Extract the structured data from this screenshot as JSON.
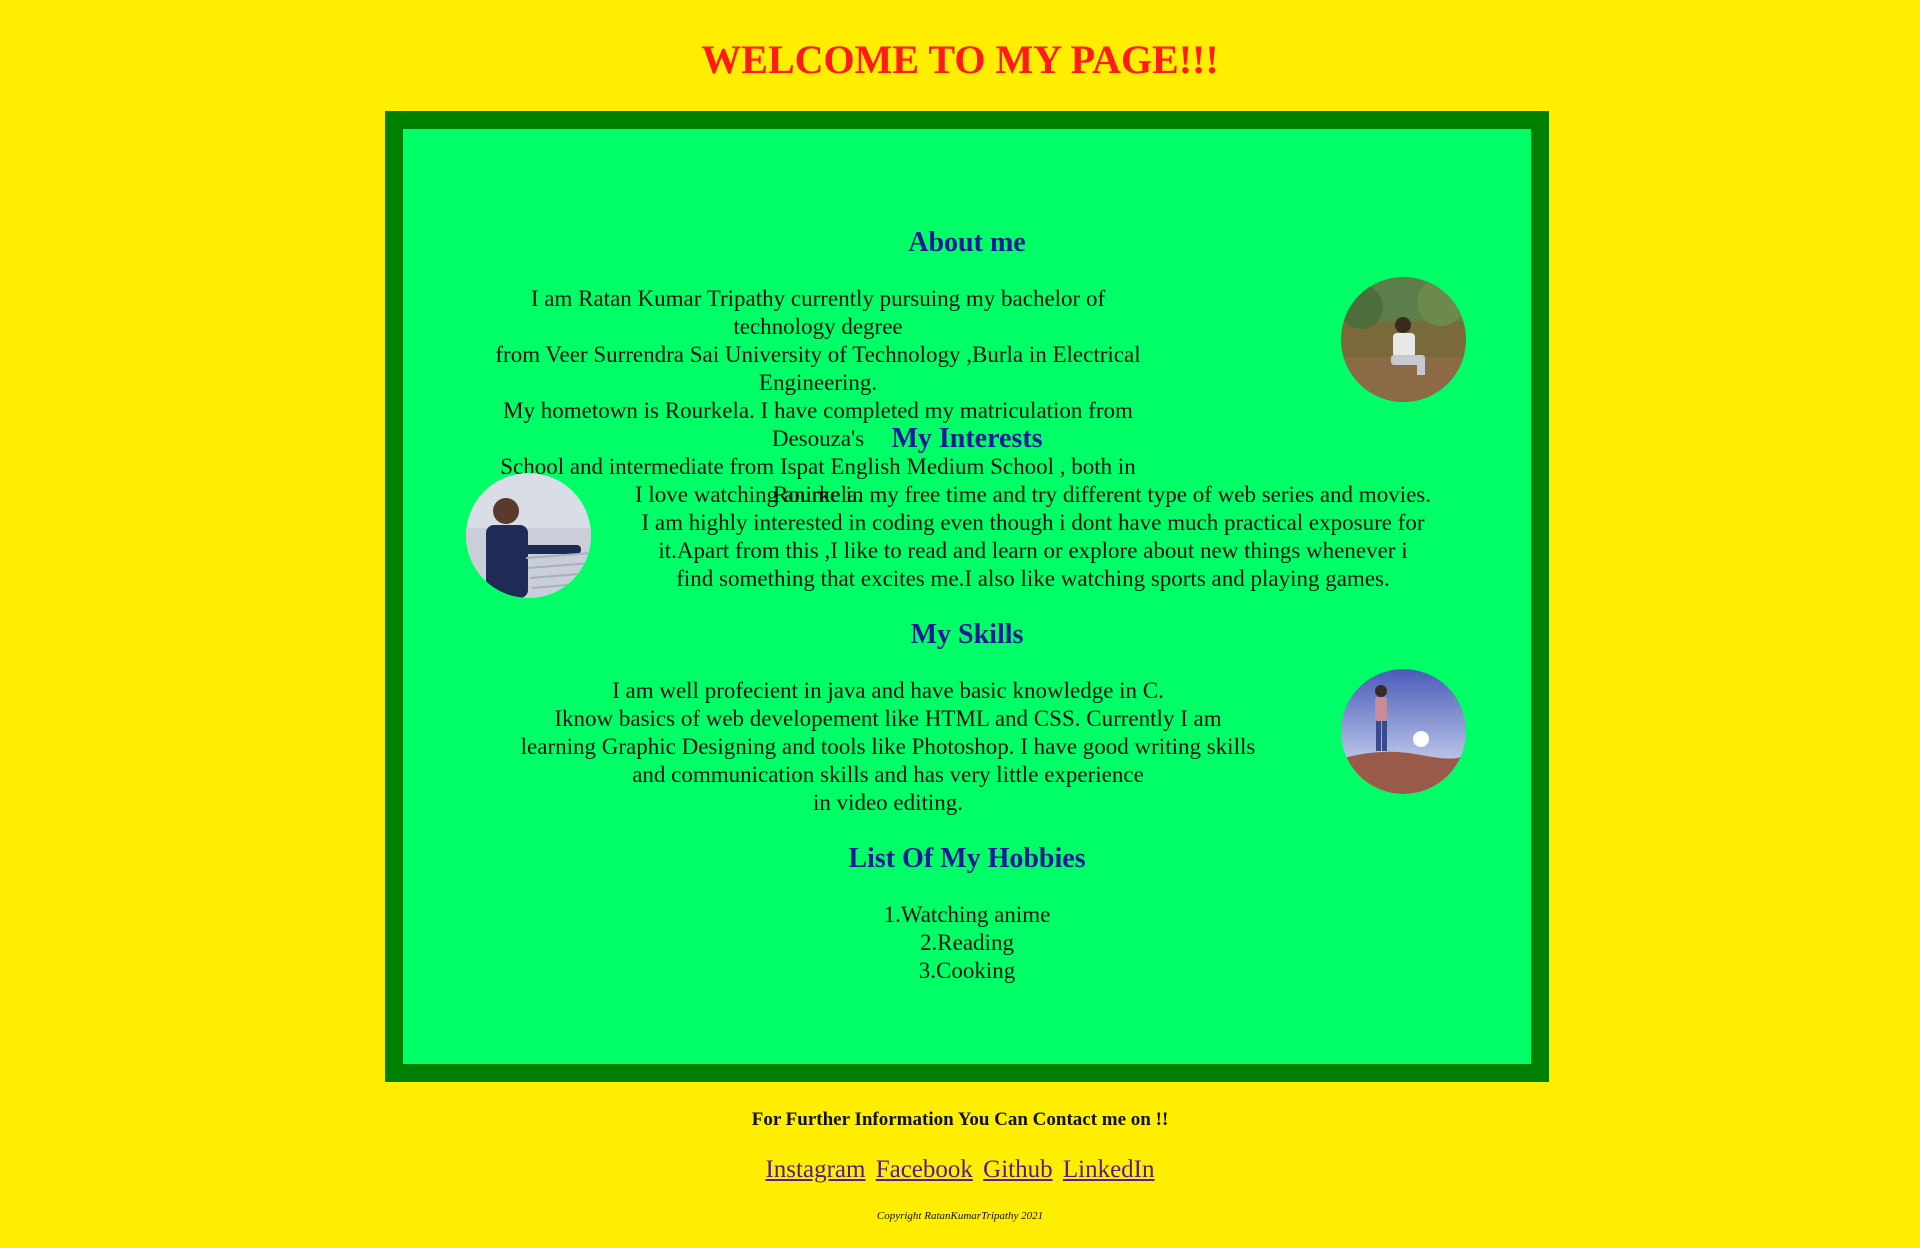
{
  "header": {
    "title": "WELCOME TO MY PAGE!!!"
  },
  "about": {
    "heading": "About me",
    "lines": [
      "I am Ratan Kumar Tripathy currently pursuing my bachelor of technology degree",
      "from Veer Surrendra Sai University of Technology ,Burla in Electrical Engineering.",
      "My hometown is Rourkela. I have completed my matriculation from Desouza's",
      "School and intermediate from Ispat English Medium School , both in Rourkela."
    ]
  },
  "interests": {
    "heading": "My Interests",
    "lines": [
      "I love watching anime in my free time and try different type of web series and movies.",
      "I am highly interested in coding even though i dont have much practical exposure for",
      "it.Apart from this ,I like to read and learn or explore about new things whenever i",
      "find something that excites me.I also like watching sports and playing games."
    ]
  },
  "skills": {
    "heading": "My Skills",
    "lines": [
      "I am well profecient in java and have basic knowledge in C.",
      "Iknow basics of web developement like HTML and CSS. Currently I am",
      "learning Graphic Designing and tools like Photoshop. I have good writing skills",
      "and communication skills and has very little experience",
      "in video editing."
    ]
  },
  "hobbies": {
    "heading": "List Of My Hobbies",
    "items": [
      "1.Watching anime",
      "2.Reading",
      "3.Cooking"
    ]
  },
  "footer": {
    "contact_text": "For Further Information You Can Contact me on !!",
    "links": [
      "Instagram",
      "Facebook",
      "Github",
      "LinkedIn"
    ],
    "copyright": "Copyright RatanKumarTripathy 2021"
  },
  "colors": {
    "page_background": "#ffee00",
    "frame_border": "#008000",
    "frame_background": "#00ff66",
    "title": "#ff1a1a",
    "heading": "#1a1a99",
    "link": "#551a8b"
  }
}
